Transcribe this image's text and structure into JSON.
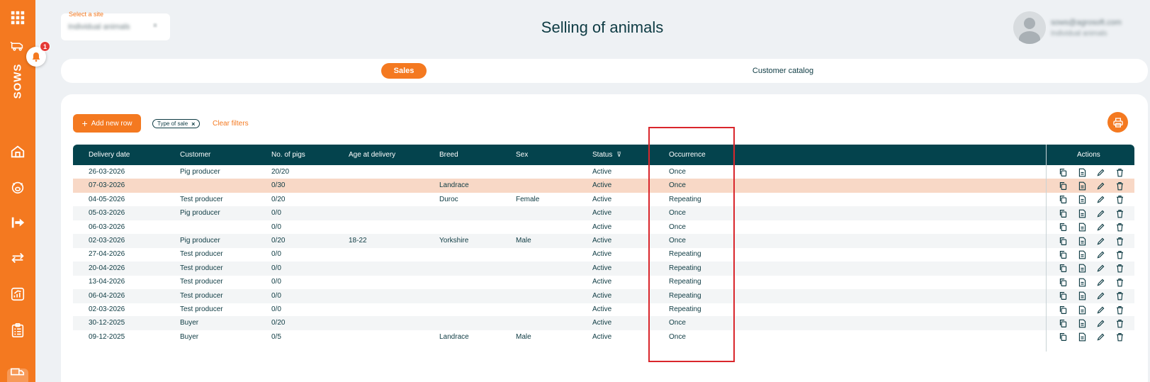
{
  "sidebar": {
    "brand": "SOWS",
    "notification_count": "1",
    "icons": [
      "grid-icon",
      "pig-truck-icon",
      "home-icon",
      "pig-icon",
      "exit-arrow-icon",
      "transfer-icon",
      "chart-icon",
      "checklist-icon",
      "truck-icon"
    ]
  },
  "site": {
    "label": "Select a site",
    "value": "Individual animals",
    "chevron": "≡"
  },
  "page_title": "Selling of animals",
  "user": {
    "email": "sows@agrosoft.com",
    "site": "Individual animals"
  },
  "tabs": {
    "sales": "Sales",
    "catalog": "Customer catalog"
  },
  "toolbar": {
    "add_label": "Add new row",
    "filter_chip": "Type of sale",
    "filter_chip_close": "×",
    "clear_filters": "Clear filters"
  },
  "table": {
    "columns": [
      "Delivery date",
      "Customer",
      "No. of pigs",
      "Age at delivery",
      "Breed",
      "Sex",
      "Status",
      "Occurrence",
      "Actions"
    ],
    "rows": [
      {
        "date": "26-03-2026",
        "customer": "Pig producer",
        "pigs": "20/20",
        "age": "",
        "breed": "",
        "sex": "",
        "status": "Active",
        "occurrence": "Once"
      },
      {
        "date": "07-03-2026",
        "customer": "",
        "pigs": "0/30",
        "age": "",
        "breed": "Landrace",
        "sex": "",
        "status": "Active",
        "occurrence": "Once"
      },
      {
        "date": "04-05-2026",
        "customer": "Test producer",
        "pigs": "0/20",
        "age": "",
        "breed": "Duroc",
        "sex": "Female",
        "status": "Active",
        "occurrence": "Repeating"
      },
      {
        "date": "05-03-2026",
        "customer": "Pig producer",
        "pigs": "0/0",
        "age": "",
        "breed": "",
        "sex": "",
        "status": "Active",
        "occurrence": "Once"
      },
      {
        "date": "06-03-2026",
        "customer": "",
        "pigs": "0/0",
        "age": "",
        "breed": "",
        "sex": "",
        "status": "Active",
        "occurrence": "Once"
      },
      {
        "date": "02-03-2026",
        "customer": "Pig producer",
        "pigs": "0/20",
        "age": "18-22",
        "breed": "Yorkshire",
        "sex": "Male",
        "status": "Active",
        "occurrence": "Once"
      },
      {
        "date": "27-04-2026",
        "customer": "Test producer",
        "pigs": "0/0",
        "age": "",
        "breed": "",
        "sex": "",
        "status": "Active",
        "occurrence": "Repeating"
      },
      {
        "date": "20-04-2026",
        "customer": "Test producer",
        "pigs": "0/0",
        "age": "",
        "breed": "",
        "sex": "",
        "status": "Active",
        "occurrence": "Repeating"
      },
      {
        "date": "13-04-2026",
        "customer": "Test producer",
        "pigs": "0/0",
        "age": "",
        "breed": "",
        "sex": "",
        "status": "Active",
        "occurrence": "Repeating"
      },
      {
        "date": "06-04-2026",
        "customer": "Test producer",
        "pigs": "0/0",
        "age": "",
        "breed": "",
        "sex": "",
        "status": "Active",
        "occurrence": "Repeating"
      },
      {
        "date": "02-03-2026",
        "customer": "Test producer",
        "pigs": "0/0",
        "age": "",
        "breed": "",
        "sex": "",
        "status": "Active",
        "occurrence": "Repeating"
      },
      {
        "date": "30-12-2025",
        "customer": "Buyer",
        "pigs": "0/20",
        "age": "",
        "breed": "",
        "sex": "",
        "status": "Active",
        "occurrence": "Once"
      },
      {
        "date": "09-12-2025",
        "customer": "Buyer",
        "pigs": "0/5",
        "age": "",
        "breed": "Landrace",
        "sex": "Male",
        "status": "Active",
        "occurrence": "Once"
      }
    ],
    "highlighted_row": 1,
    "row_actions": [
      "copy-icon",
      "document-icon",
      "edit-icon",
      "delete-icon"
    ]
  },
  "colors": {
    "accent": "#f47920",
    "header": "#04434d",
    "highlight_row": "#f8d8c6",
    "annotation_box": "#d9262c"
  }
}
